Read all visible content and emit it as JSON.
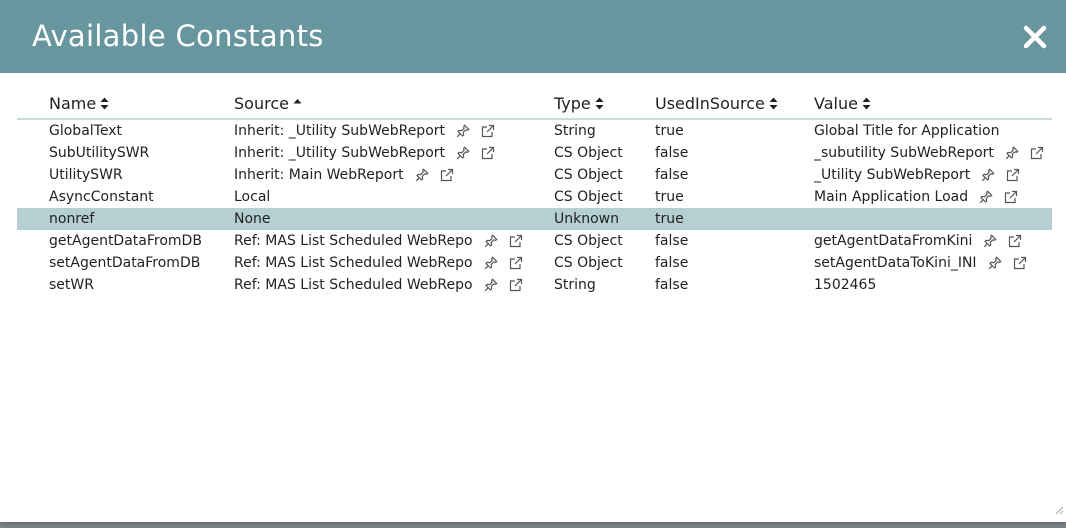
{
  "dialog": {
    "title": "Available Constants"
  },
  "columns": [
    {
      "label": "Name",
      "sort": "both"
    },
    {
      "label": "Source",
      "sort": "asc"
    },
    {
      "label": "Type",
      "sort": "both"
    },
    {
      "label": "UsedInSource",
      "sort": "both"
    },
    {
      "label": "Value",
      "sort": "both"
    }
  ],
  "rows": [
    {
      "name": "GlobalText",
      "source": "Inherit: _Utility SubWebReport",
      "source_icons": true,
      "type": "String",
      "used": "true",
      "value": "Global Title for Application",
      "value_icons": false
    },
    {
      "name": "SubUtilitySWR",
      "source": "Inherit: _Utility SubWebReport",
      "source_icons": true,
      "type": "CS Object",
      "used": "false",
      "value": "_subutility SubWebReport",
      "value_icons": true
    },
    {
      "name": "UtilitySWR",
      "source": "Inherit: Main WebReport",
      "source_icons": true,
      "type": "CS Object",
      "used": "false",
      "value": "_Utility SubWebReport",
      "value_icons": true
    },
    {
      "name": "AsyncConstant",
      "source": "Local",
      "source_icons": false,
      "type": "CS Object",
      "used": "true",
      "value": "Main Application Load",
      "value_icons": true
    },
    {
      "name": "nonref",
      "source": "None",
      "source_icons": false,
      "type": "Unknown",
      "used": "true",
      "value": "",
      "value_icons": false,
      "selected": true
    },
    {
      "name": "getAgentDataFromDB",
      "source": "Ref: MAS List Scheduled WebRepo",
      "source_icons": true,
      "type": "CS Object",
      "used": "false",
      "value": "getAgentDataFromKini",
      "value_icons": true
    },
    {
      "name": "setAgentDataFromDB",
      "source": "Ref: MAS List Scheduled WebRepo",
      "source_icons": true,
      "type": "CS Object",
      "used": "false",
      "value": "setAgentDataToKini_INI",
      "value_icons": true
    },
    {
      "name": "setWR",
      "source": "Ref: MAS List Scheduled WebRepo",
      "source_icons": true,
      "type": "String",
      "used": "false",
      "value": "1502465",
      "value_icons": false
    }
  ],
  "icons": {
    "close": "close-icon",
    "pin": "pin-icon",
    "open": "external-link-icon",
    "sort_both": "sort-both-icon",
    "sort_asc": "sort-asc-icon"
  },
  "colors": {
    "titlebar": "#67969e",
    "selected_row": "#b6cfd3",
    "header_rule": "#c9d9dc"
  }
}
